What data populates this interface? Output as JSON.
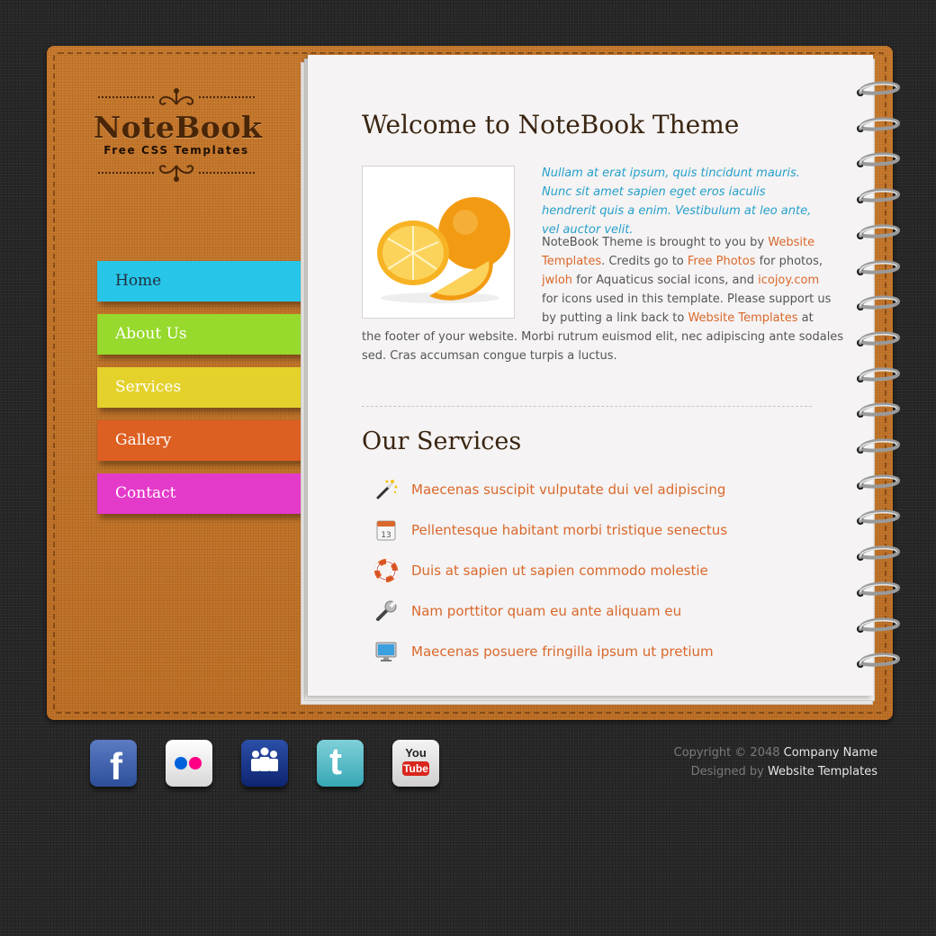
{
  "brand": {
    "title": "NoteBook",
    "subtitle": "Free CSS Templates"
  },
  "nav": [
    {
      "label": "Home",
      "color": "#27c6e8"
    },
    {
      "label": "About Us",
      "color": "#97d92c"
    },
    {
      "label": "Services",
      "color": "#e4d12c"
    },
    {
      "label": "Gallery",
      "color": "#dd5f22"
    },
    {
      "label": "Contact",
      "color": "#e43ac9"
    }
  ],
  "main": {
    "heading": "Welcome to NoteBook Theme",
    "image_icon": "orange-photo",
    "intro": "Nullam at erat ipsum, quis tincidunt mauris. Nunc sit amet sapien eget eros iaculis hendrerit quis a enim. Vestibulum at leo ante, vel auctor velit.",
    "body": {
      "p1": "NoteBook Theme is brought to you by ",
      "link1a": "Website",
      "link1b": "Templates",
      "p2": ". Credits go to ",
      "link2": "Free Photos",
      "p3": " for photos,",
      "link3": "jwloh",
      "p4": " for Aquaticus social icons, and ",
      "link4": "icojoy.com",
      "p5": "for icons used in this template. Please support us",
      "p6": "by putting a link back to ",
      "link5": "Website Templates",
      "p7": " at",
      "p8": "the footer of your website. Morbi rutrum euismod elit, nec adipiscing ante sodales",
      "p9": "sed. Cras accumsan congue turpis a luctus."
    },
    "services_heading": "Our Services",
    "services": [
      {
        "icon": "magic-wand-icon",
        "label": "Maecenas suscipit vulputate dui vel adipiscing"
      },
      {
        "icon": "calendar-icon",
        "label": "Pellentesque habitant morbi tristique senectus"
      },
      {
        "icon": "lifebuoy-icon",
        "label": "Duis at sapien ut sapien commodo molestie"
      },
      {
        "icon": "wrench-icon",
        "label": "Nam porttitor quam eu ante aliquam eu"
      },
      {
        "icon": "monitor-icon",
        "label": "Maecenas posuere fringilla ipsum ut pretium"
      }
    ],
    "calendar_day": "13"
  },
  "social": [
    {
      "icon": "facebook-icon",
      "glyph": "f"
    },
    {
      "icon": "flickr-icon"
    },
    {
      "icon": "myspace-icon"
    },
    {
      "icon": "twitter-icon",
      "glyph": "t"
    },
    {
      "icon": "youtube-icon",
      "glyph1": "You",
      "glyph2": "Tube"
    }
  ],
  "footer": {
    "copyright_prefix": "Copyright © 2048 ",
    "company": "Company Name",
    "designed_prefix": "Designed by ",
    "designer": "Website Templates"
  },
  "colors": {
    "accent_link": "#d9682c",
    "intro_blue": "#27a0cc",
    "leather": "#c6772a"
  }
}
